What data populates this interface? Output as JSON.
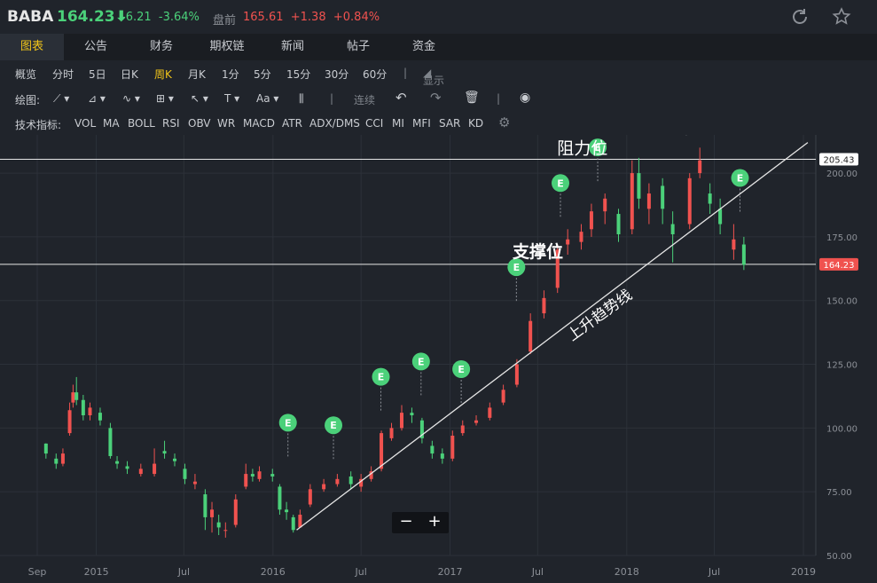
{
  "header": {
    "symbol": "BABA",
    "price": "164.23⬇",
    "change": "-6.21",
    "change_pct": "-3.64%",
    "premarket_label": "盘前",
    "premarket_price": "165.61",
    "premarket_change": "+1.38",
    "premarket_pct": "+0.84%"
  },
  "tabs": [
    "图表",
    "公告",
    "财务",
    "期权链",
    "新闻",
    "帖子",
    "资金"
  ],
  "periods": [
    "概览",
    "分时",
    "5日",
    "日K",
    "周K",
    "月K",
    "1分",
    "5分",
    "15分",
    "30分",
    "60分"
  ],
  "period_active": "周K",
  "display_label": "显示",
  "draw_label": "绘图:",
  "draw_lianxu": "连续",
  "indicators_label": "技术指标:",
  "indicators": [
    "VOL",
    "MA",
    "BOLL",
    "RSI",
    "OBV",
    "WR",
    "MACD",
    "ATR",
    "ADX/DMS",
    "CCI",
    "MI",
    "MFI",
    "SAR",
    "KD"
  ],
  "colors": {
    "up": "#f0524f",
    "down": "#4bd17a",
    "accent": "#f0c419"
  },
  "annotations": {
    "resistance": "阻力位",
    "support": "支撑位",
    "trendline": "上升趋势线"
  },
  "chart_data": {
    "type": "candlestick",
    "ylim": [
      50,
      215
    ],
    "y_ticks": [
      "200.00",
      "175.00",
      "150.00",
      "125.00",
      "100.00",
      "75.00",
      "50.00"
    ],
    "x_ticks": [
      "Sep",
      "2015",
      "Jul",
      "2016",
      "Jul",
      "2017",
      "Jul",
      "2018",
      "Jul",
      "2019"
    ],
    "resistance_level": 205.43,
    "resistance_label": "205.43",
    "current_level": 164.23,
    "current_label": "164.23",
    "earnings_marker": "E",
    "earnings_dates": [
      "2016-02-01",
      "2016-05-05",
      "2016-08-11",
      "2016-11-02",
      "2017-01-24",
      "2017-05-18",
      "2017-08-17",
      "2017-11-02",
      "2018-05-04",
      "2018-08-23"
    ],
    "trendline_from": [
      "2016-02-19",
      60
    ],
    "trendline_to": [
      "2019-01-10",
      212
    ],
    "candles": [
      [
        "2014-09-19",
        93.9,
        90.0,
        94.0,
        88.0
      ],
      [
        "2014-10-10",
        88.0,
        86.0,
        90.0,
        84.0
      ],
      [
        "2014-10-24",
        86.0,
        90.0,
        92.0,
        85.0
      ],
      [
        "2014-11-07",
        98.0,
        107.0,
        110.0,
        97.0
      ],
      [
        "2014-11-14",
        110.0,
        114.0,
        117.0,
        108.0
      ],
      [
        "2014-11-21",
        114.0,
        111.0,
        120.0,
        109.0
      ],
      [
        "2014-12-05",
        111.0,
        105.0,
        113.0,
        103.0
      ],
      [
        "2014-12-19",
        105.0,
        108.0,
        110.0,
        103.0
      ],
      [
        "2015-01-09",
        106.0,
        103.0,
        108.0,
        101.0
      ],
      [
        "2015-01-30",
        100.0,
        89.0,
        102.0,
        88.0
      ],
      [
        "2015-02-13",
        87.0,
        86.0,
        89.0,
        84.0
      ],
      [
        "2015-03-06",
        85.0,
        84.0,
        87.0,
        82.0
      ],
      [
        "2015-04-03",
        82.0,
        84.0,
        86.0,
        81.0
      ],
      [
        "2015-05-01",
        82.0,
        86.0,
        92.0,
        81.0
      ],
      [
        "2015-05-22",
        91.0,
        90.0,
        95.0,
        88.0
      ],
      [
        "2015-06-12",
        88.0,
        87.0,
        90.0,
        85.0
      ],
      [
        "2015-07-03",
        84.0,
        80.0,
        86.0,
        78.0
      ],
      [
        "2015-07-24",
        78.0,
        79.0,
        82.0,
        76.0
      ],
      [
        "2015-08-14",
        74.0,
        65.0,
        76.0,
        60.0
      ],
      [
        "2015-08-28",
        65.0,
        68.0,
        71.0,
        59.0
      ],
      [
        "2015-09-11",
        63.0,
        61.0,
        66.0,
        58.0
      ],
      [
        "2015-09-25",
        60.0,
        60.0,
        63.0,
        57.0
      ],
      [
        "2015-10-16",
        62.0,
        72.0,
        74.0,
        61.0
      ],
      [
        "2015-11-06",
        77.0,
        82.0,
        86.0,
        76.0
      ],
      [
        "2015-11-20",
        82.0,
        81.0,
        84.0,
        79.0
      ],
      [
        "2015-12-04",
        80.0,
        83.0,
        85.0,
        79.0
      ],
      [
        "2015-12-31",
        82.0,
        81.0,
        84.0,
        79.0
      ],
      [
        "2016-01-15",
        77.0,
        68.0,
        78.0,
        66.0
      ],
      [
        "2016-01-29",
        68.0,
        67.0,
        71.0,
        64.0
      ],
      [
        "2016-02-12",
        65.0,
        60.0,
        66.0,
        59.0
      ],
      [
        "2016-02-26",
        61.0,
        66.0,
        68.0,
        61.0
      ],
      [
        "2016-03-18",
        70.0,
        76.0,
        78.0,
        69.0
      ],
      [
        "2016-04-15",
        76.0,
        78.0,
        80.0,
        75.0
      ],
      [
        "2016-05-13",
        78.0,
        80.0,
        82.0,
        77.0
      ],
      [
        "2016-06-10",
        81.0,
        78.0,
        83.0,
        76.0
      ],
      [
        "2016-07-01",
        77.0,
        80.0,
        82.0,
        75.0
      ],
      [
        "2016-07-22",
        80.0,
        83.0,
        85.0,
        79.0
      ],
      [
        "2016-08-12",
        84.0,
        98.0,
        99.0,
        83.0
      ],
      [
        "2016-09-02",
        96.0,
        100.0,
        102.0,
        95.0
      ],
      [
        "2016-09-23",
        100.0,
        106.0,
        109.0,
        99.0
      ],
      [
        "2016-10-14",
        106.0,
        105.0,
        108.0,
        102.0
      ],
      [
        "2016-11-04",
        103.0,
        96.0,
        104.0,
        94.0
      ],
      [
        "2016-11-25",
        93.0,
        90.0,
        95.0,
        88.0
      ],
      [
        "2016-12-16",
        90.0,
        88.0,
        92.0,
        86.0
      ],
      [
        "2017-01-06",
        88.0,
        97.0,
        99.0,
        87.0
      ],
      [
        "2017-01-27",
        98.0,
        101.0,
        103.0,
        97.0
      ],
      [
        "2017-02-24",
        102.0,
        103.0,
        105.0,
        101.0
      ],
      [
        "2017-03-24",
        104.0,
        108.0,
        110.0,
        103.0
      ],
      [
        "2017-04-21",
        110.0,
        115.0,
        117.0,
        109.0
      ],
      [
        "2017-05-19",
        117.0,
        125.0,
        127.0,
        116.0
      ],
      [
        "2017-06-16",
        130.0,
        142.0,
        145.0,
        129.0
      ],
      [
        "2017-07-14",
        145.0,
        151.0,
        154.0,
        143.0
      ],
      [
        "2017-08-11",
        155.0,
        170.0,
        172.0,
        153.0
      ],
      [
        "2017-09-01",
        172.0,
        174.0,
        178.0,
        168.0
      ],
      [
        "2017-09-29",
        173.0,
        177.0,
        180.0,
        170.0
      ],
      [
        "2017-10-20",
        178.0,
        185.0,
        188.0,
        175.0
      ],
      [
        "2017-11-17",
        185.0,
        190.0,
        192.0,
        180.0
      ],
      [
        "2017-12-15",
        184.0,
        176.0,
        186.0,
        173.0
      ],
      [
        "2018-01-12",
        178.0,
        200.0,
        205.0,
        176.0
      ],
      [
        "2018-01-26",
        200.0,
        190.0,
        206.0,
        186.0
      ],
      [
        "2018-02-16",
        186.0,
        192.0,
        196.0,
        180.0
      ],
      [
        "2018-03-16",
        195.0,
        186.0,
        198.0,
        180.0
      ],
      [
        "2018-04-06",
        180.0,
        176.0,
        185.0,
        165.0
      ],
      [
        "2018-05-11",
        180.0,
        198.0,
        200.0,
        178.0
      ],
      [
        "2018-06-01",
        200.0,
        205.0,
        210.0,
        198.0
      ],
      [
        "2018-06-22",
        192.0,
        188.0,
        196.0,
        184.0
      ],
      [
        "2018-07-13",
        186.0,
        180.0,
        190.0,
        176.0
      ],
      [
        "2018-08-10",
        170.0,
        174.0,
        180.0,
        166.0
      ],
      [
        "2018-08-31",
        172.0,
        164.0,
        175.0,
        162.0
      ]
    ]
  }
}
